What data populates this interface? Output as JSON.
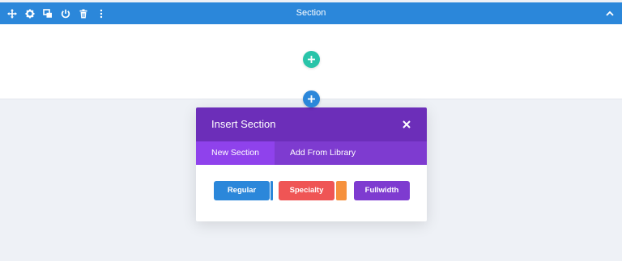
{
  "section": {
    "title": "Section",
    "toolbar_icons": [
      "move-icon",
      "gear-icon",
      "duplicate-icon",
      "power-icon",
      "trash-icon",
      "more-icon"
    ],
    "collapse_icon": "chevron-up-icon"
  },
  "add_row_button": {
    "icon": "plus-icon"
  },
  "add_section_button": {
    "icon": "plus-icon"
  },
  "insert_section_modal": {
    "title": "Insert Section",
    "close_icon": "close-icon",
    "tabs": [
      {
        "label": "New Section",
        "active": true
      },
      {
        "label": "Add From Library",
        "active": false
      }
    ],
    "options": [
      {
        "label": "Regular",
        "color": "#2b87da"
      },
      {
        "label": "Specialty",
        "color": "#ef5555",
        "accent": "#f6913d"
      },
      {
        "label": "Fullwidth",
        "color": "#7e3bd0"
      }
    ]
  },
  "colors": {
    "section_bar": "#2b87da",
    "add_row": "#29c4a9",
    "modal_header": "#6c2eb9",
    "modal_tabs": "#7e3bd0",
    "modal_tab_active": "#8f42ec",
    "page_background": "#eef1f6"
  }
}
